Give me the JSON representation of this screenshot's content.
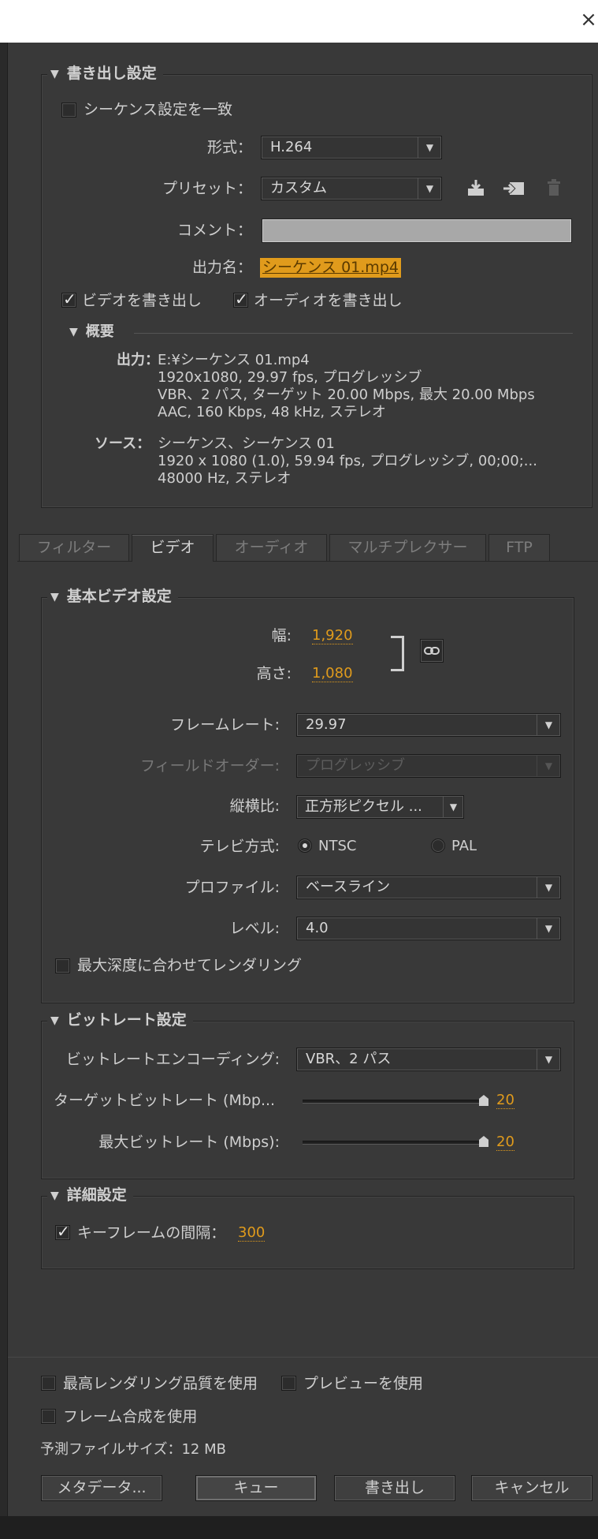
{
  "window": {
    "close_glyph": "×"
  },
  "export_settings": {
    "title": "書き出し設定",
    "match_sequence_label": "シーケンス設定を一致",
    "match_sequence_checked": false,
    "format_label": "形式：",
    "format_value": "H.264",
    "preset_label": "プリセット：",
    "preset_value": "カスタム",
    "comment_label": "コメント：",
    "comment_value": "",
    "output_name_label": "出力名：",
    "output_name_value": "シーケンス 01.mp4",
    "export_video_label": "ビデオを書き出し",
    "export_video_checked": true,
    "export_audio_label": "オーディオを書き出し",
    "export_audio_checked": true
  },
  "summary": {
    "title": "概要",
    "output_label": "出力：",
    "output_lines": [
      "E:¥シーケンス 01.mp4",
      "1920x1080, 29.97 fps, プログレッシブ",
      "VBR、2 パス, ターゲット 20.00 Mbps, 最大 20.00 Mbps",
      "AAC, 160 Kbps, 48 kHz, ステレオ"
    ],
    "source_label": "ソース：",
    "source_lines": [
      "シーケンス、シーケンス 01",
      "1920 x 1080 (1.0), 59.94 fps, プログレッシブ, 00;00;...",
      "48000 Hz, ステレオ"
    ]
  },
  "tabs": [
    {
      "label": "フィルター",
      "active": false
    },
    {
      "label": "ビデオ",
      "active": true
    },
    {
      "label": "オーディオ",
      "active": false
    },
    {
      "label": "マルチプレクサー",
      "active": false
    },
    {
      "label": "FTP",
      "active": false
    }
  ],
  "basic_video": {
    "title": "基本ビデオ設定",
    "width_label": "幅:",
    "width_value": "1,920",
    "height_label": "高さ:",
    "height_value": "1,080",
    "framerate_label": "フレームレート:",
    "framerate_value": "29.97",
    "field_order_label": "フィールドオーダー:",
    "field_order_value": "プログレッシブ",
    "aspect_label": "縦横比:",
    "aspect_value": "正方形ピクセル ...",
    "tv_standard_label": "テレビ方式:",
    "tv_ntsc": "NTSC",
    "tv_pal": "PAL",
    "tv_selected": "NTSC",
    "profile_label": "プロファイル:",
    "profile_value": "ベースライン",
    "level_label": "レベル:",
    "level_value": "4.0",
    "max_depth_label": "最大深度に合わせてレンダリング",
    "max_depth_checked": false
  },
  "bitrate": {
    "title": "ビットレート設定",
    "encoding_label": "ビットレートエンコーディング:",
    "encoding_value": "VBR、2 パス",
    "target_label": "ターゲットビットレート (Mbp...",
    "target_value": "20",
    "target_fraction": 1.0,
    "max_label": "最大ビットレート (Mbps):",
    "max_value": "20",
    "max_fraction": 1.0
  },
  "advanced": {
    "title": "詳細設定",
    "keyframe_label": "キーフレームの間隔：",
    "keyframe_value": "300",
    "keyframe_checked": true
  },
  "footer": {
    "max_quality_label": "最高レンダリング品質を使用",
    "max_quality_checked": false,
    "use_preview_label": "プレビューを使用",
    "use_preview_checked": false,
    "frame_blend_label": "フレーム合成を使用",
    "frame_blend_checked": false,
    "estimated_size": "予測ファイルサイズ：12 MB",
    "metadata_button": "メタデータ...",
    "queue_button": "キュー",
    "export_button": "書き出し",
    "cancel_button": "キャンセル"
  }
}
